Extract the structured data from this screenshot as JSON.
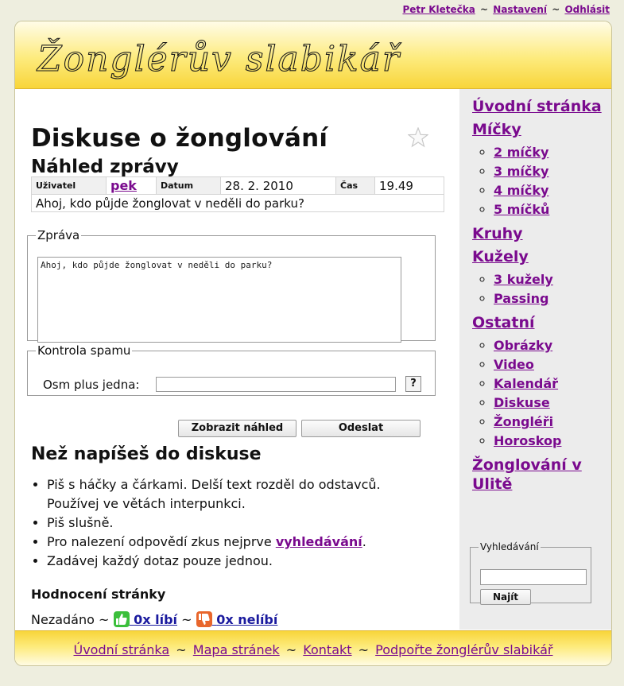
{
  "top_links": {
    "user": "Petr Kletečka",
    "settings": "Nastavení",
    "logout": "Odhlásit",
    "sep": "~"
  },
  "site_title": "Žonglérův slabikář",
  "page_title": "Diskuse o žonglování",
  "preview_title": "Náhled zprávy",
  "message": {
    "user_label": "Uživatel",
    "user": "pek",
    "date_label": "Datum",
    "date": "28. 2. 2010",
    "time_label": "Čas",
    "time": "19.49",
    "text": "Ahoj, kdo půjde žonglovat v neděli do parku?"
  },
  "form": {
    "message_legend": "Zpráva",
    "message_value": "Ahoj, kdo půjde žonglovat v neděli do parku?",
    "spam_legend": "Kontrola spamu",
    "spam_question": "Osm plus jedna:",
    "spam_value": "",
    "help": "?",
    "preview_button": "Zobrazit náhled",
    "send_button": "Odeslat"
  },
  "rules": {
    "title": "Než napíšeš do diskuse",
    "items": [
      "Piš s háčky a čárkami. Delší text rozděl do odstavců. Používej ve větách interpunkci.",
      "Piš slušně.",
      "Zadávej každý dotaz pouze jednou."
    ],
    "search_tip_prefix": "Pro nalezení odpovědí zkus nejprve ",
    "search_tip_link": "vyhledávání",
    "search_tip_suffix": "."
  },
  "rating": {
    "title": "Hodnocení stránky",
    "status": "Nezadáno",
    "sep": "~",
    "likes": "0x líbí",
    "dislikes": "0x nelíbí"
  },
  "sidebar": {
    "home": "Úvodní stránka",
    "balls": "Míčky",
    "balls_items": [
      "2 míčky",
      "3 míčky",
      "4 míčky",
      "5 míčků"
    ],
    "rings": "Kruhy",
    "clubs": "Kužely",
    "clubs_items": [
      "3 kužely",
      "Passing"
    ],
    "other": "Ostatní",
    "other_items": [
      "Obrázky",
      "Video",
      "Kalendář",
      "Diskuse",
      "Žongléři",
      "Horoskop"
    ],
    "ulita": "Žonglování v Ulitě",
    "search_legend": "Vyhledávání",
    "search_value": "",
    "search_button": "Najít"
  },
  "footer": {
    "home": "Úvodní stránka",
    "sitemap": "Mapa stránek",
    "contact": "Kontakt",
    "support": "Podpořte žonglérův slabikář",
    "sep": "~"
  },
  "colors": {
    "link": "#7a0a8e",
    "header_yellow": "#f8d53a",
    "like": "#3bbf3b",
    "dislike": "#e8662c"
  }
}
